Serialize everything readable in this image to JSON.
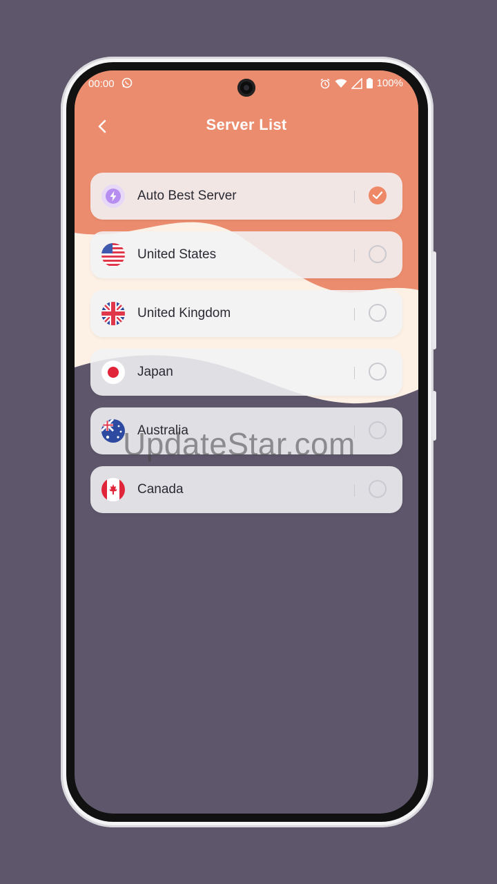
{
  "status_bar": {
    "time": "00:00",
    "battery": "100%",
    "icons": [
      "whatsapp-icon",
      "alarm-icon",
      "wifi-icon",
      "signal-icon",
      "battery-icon"
    ]
  },
  "header": {
    "title": "Server List",
    "back_icon": "chevron-left-icon"
  },
  "servers": [
    {
      "name": "Auto Best Server",
      "icon": "lightning-icon",
      "selected": true
    },
    {
      "name": "United States",
      "icon": "flag-us-icon",
      "selected": false
    },
    {
      "name": "United Kingdom",
      "icon": "flag-uk-icon",
      "selected": false
    },
    {
      "name": "Japan",
      "icon": "flag-jp-icon",
      "selected": false
    },
    {
      "name": "Australia",
      "icon": "flag-au-icon",
      "selected": false
    },
    {
      "name": "Canada",
      "icon": "flag-ca-icon",
      "selected": false
    }
  ],
  "watermark": "UpdateStar.com",
  "colors": {
    "accent": "#ee8867",
    "header_bg": "#ec8c6e",
    "wave_cream": "#fdf1e6",
    "background": "#5e566a"
  }
}
